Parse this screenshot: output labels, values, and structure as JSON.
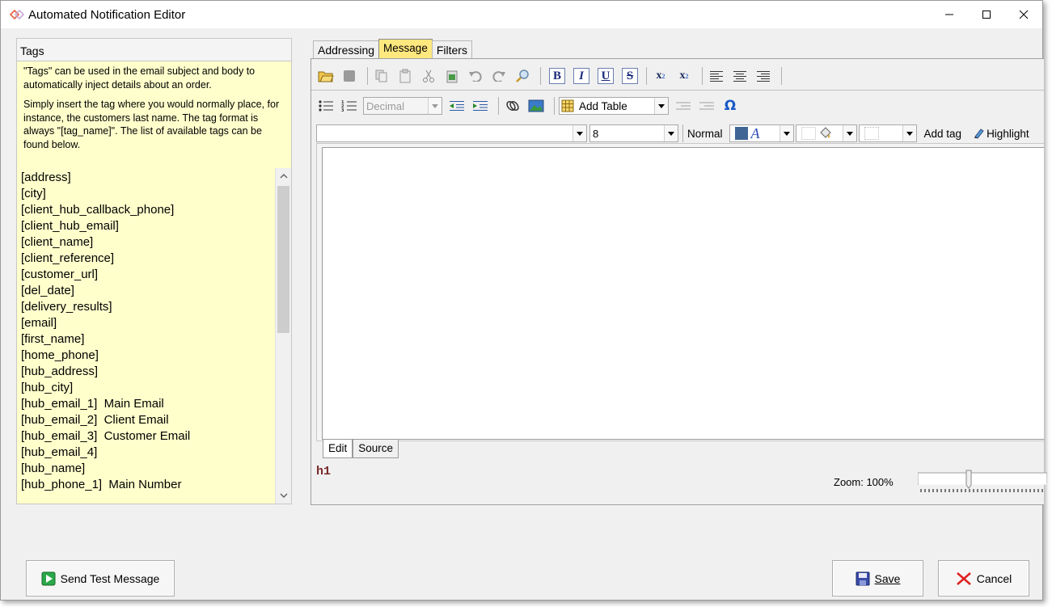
{
  "window": {
    "title": "Automated Notification Editor"
  },
  "tags_panel": {
    "header": "Tags",
    "desc_1": "\"Tags\" can be used in the email subject and body to automatically inject details about an order.",
    "desc_2": "Simply insert the tag where you would normally place, for instance, the customers last name.  The tag format is always \"[tag_name]\".  The list of available tags can be found below.",
    "items": [
      "[address]",
      "[city]",
      "[client_hub_callback_phone]",
      "[client_hub_email]",
      "[client_name]",
      "[client_reference]",
      "[customer_url]",
      "[del_date]",
      "[delivery_results]",
      "[email]",
      "[first_name]",
      "[home_phone]",
      "[hub_address]",
      "[hub_city]",
      "[hub_email_1]  Main Email",
      "[hub_email_2]  Client Email",
      "[hub_email_3]  Customer Email",
      "[hub_email_4]",
      "[hub_name]",
      "[hub_phone_1]  Main Number"
    ]
  },
  "tabs": [
    "Addressing",
    "Message",
    "Filters"
  ],
  "toolbar": {
    "list_style": "Decimal",
    "add_table": "Add Table",
    "font_size": "8",
    "normal_label": "Normal",
    "add_tag": "Add tag",
    "highlight": "Highlight"
  },
  "editor": {
    "mode_edit": "Edit",
    "mode_source": "Source",
    "element_path": "h1",
    "zoom": "Zoom: 100%"
  },
  "buttons": {
    "send_test": "Send Test Message",
    "save": "Save",
    "cancel": "Cancel"
  }
}
